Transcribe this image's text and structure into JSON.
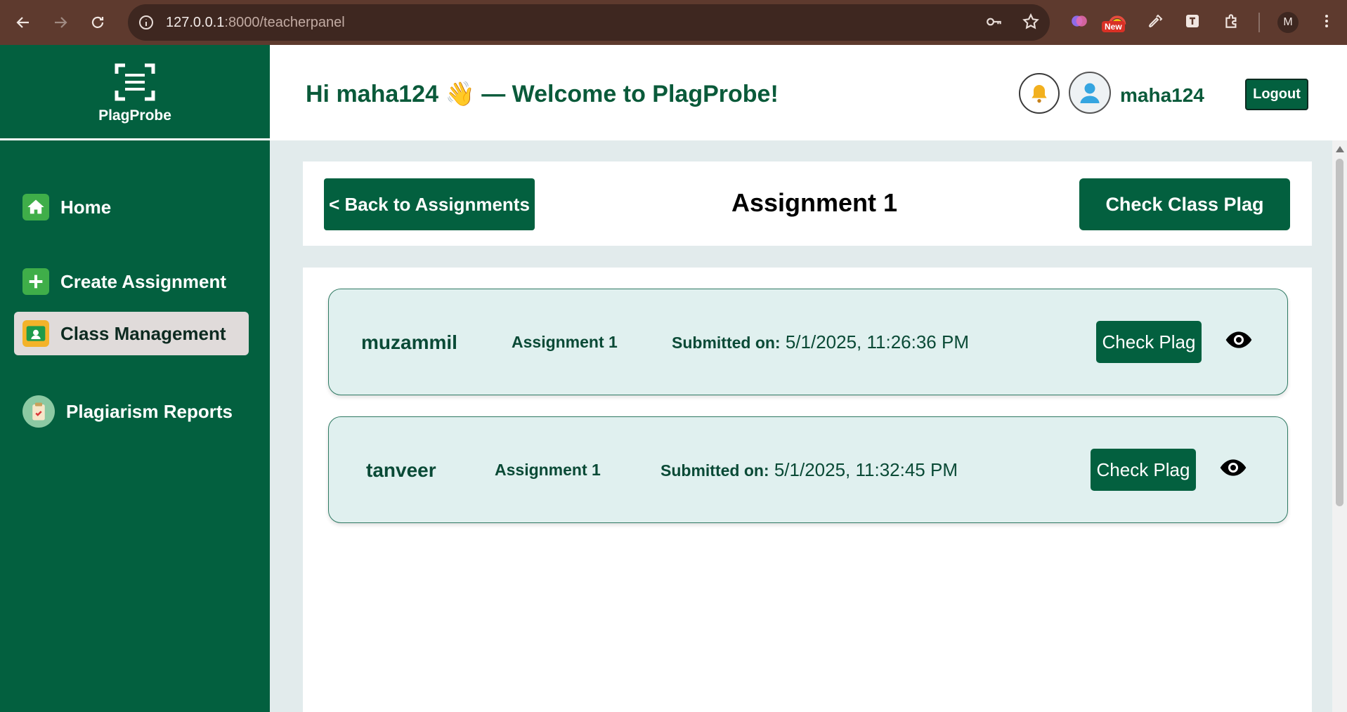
{
  "browser": {
    "url_host": "127.0.0.1",
    "url_rest": ":8000/teacherpanel",
    "new_badge": "New",
    "profile_initial": "M",
    "icons": [
      "back-arrow-icon",
      "forward-arrow-icon",
      "reload-icon",
      "site-info-icon",
      "key-icon",
      "star-icon",
      "extension-brain-icon",
      "extension-rainbow-icon",
      "eyedropper-icon",
      "text-extension-icon",
      "puzzle-icon",
      "kebab-menu-icon"
    ]
  },
  "sidebar": {
    "logo_text": "PlagProbe",
    "items": [
      {
        "label": "Home",
        "icon": "home-icon",
        "active": false
      },
      {
        "label": "Create Assignment",
        "icon": "plus-icon",
        "active": false
      },
      {
        "label": "Class Management",
        "icon": "classroom-icon",
        "active": true
      },
      {
        "label": "Plagiarism Reports",
        "icon": "clipboard-icon",
        "active": false
      }
    ]
  },
  "header": {
    "greeting": "Hi maha124 👋 — Welcome to PlagProbe!",
    "username": "maha124",
    "logout_label": "Logout"
  },
  "topbar": {
    "back_label": "< Back to Assignments",
    "title": "Assignment 1",
    "check_class_label": "Check Class Plag"
  },
  "submissions": [
    {
      "student": "muzammil",
      "assignment": "Assignment 1",
      "submitted_label": "Submitted on:",
      "submitted_value": "5/1/2025, 11:26:36 PM",
      "check_label": "Check Plag"
    },
    {
      "student": "tanveer",
      "assignment": "Assignment 1",
      "submitted_label": "Submitted on:",
      "submitted_value": "5/1/2025, 11:32:45 PM",
      "check_label": "Check Plag"
    }
  ],
  "colors": {
    "primary_green": "#03603f",
    "card_bg": "#e0f0ef",
    "main_bg": "#e2ebec",
    "chrome_brown": "#5e3a2e"
  }
}
